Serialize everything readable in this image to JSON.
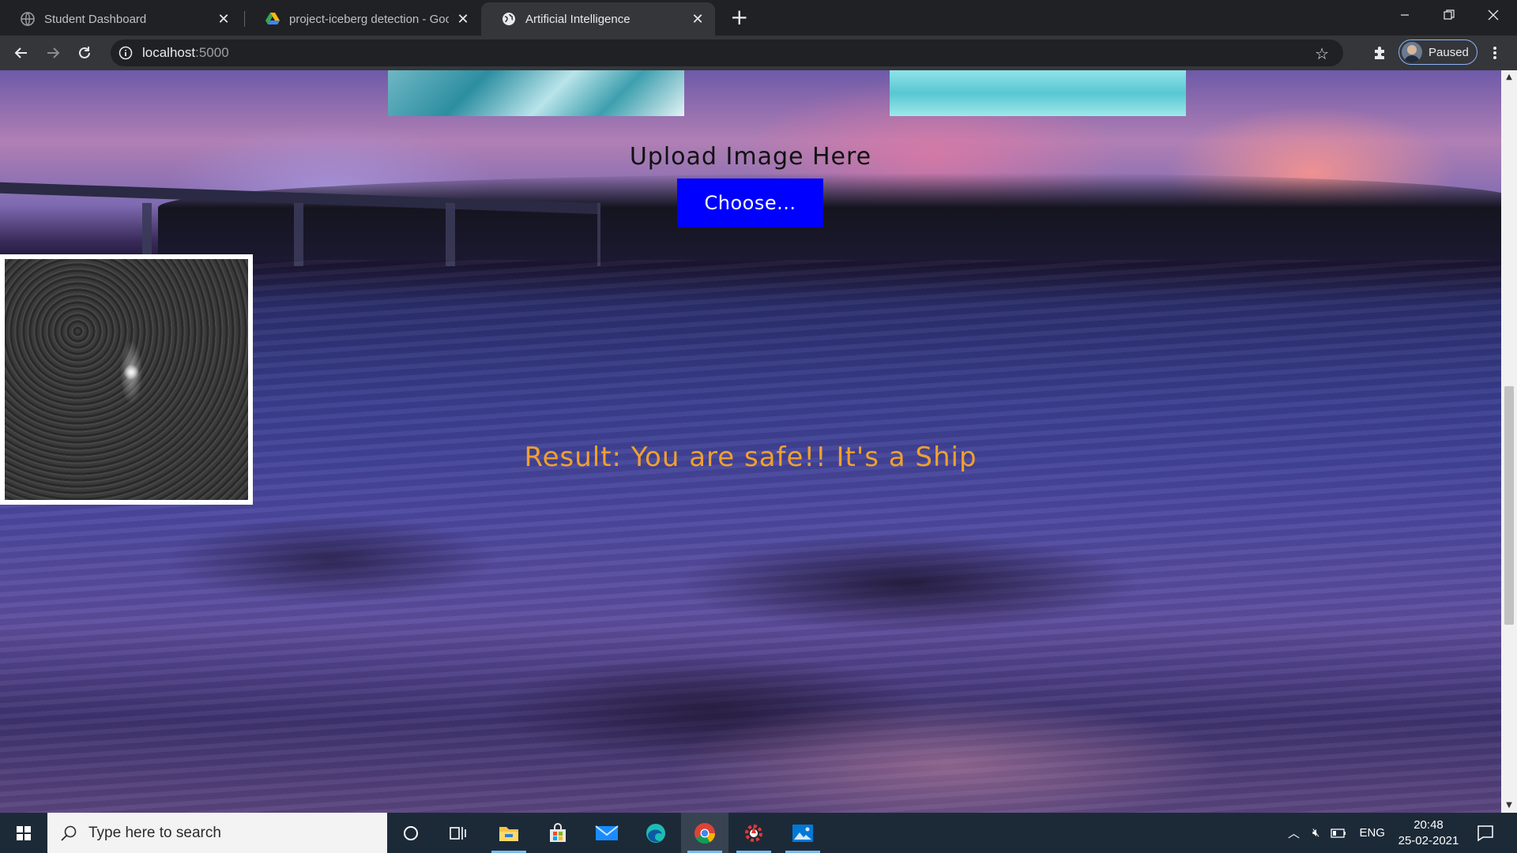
{
  "browser": {
    "tabs": [
      {
        "label": "Student Dashboard",
        "active": false
      },
      {
        "label": "project-iceberg detection - Goog",
        "active": false
      },
      {
        "label": "Artificial Intelligence",
        "active": true
      }
    ],
    "new_tab_symbol": "+",
    "url_host": "localhost",
    "url_port": ":5000",
    "profile_label": "Paused"
  },
  "page": {
    "upload_title": "Upload Image Here",
    "choose_label": "Choose...",
    "result_text": "Result: You are safe!! It's a Ship",
    "colors": {
      "choose_button": "#0000ff",
      "result_text": "#f0a030"
    }
  },
  "taskbar": {
    "search_placeholder": "Type here to search",
    "language": "ENG",
    "time": "20:48",
    "date": "25-02-2021"
  }
}
